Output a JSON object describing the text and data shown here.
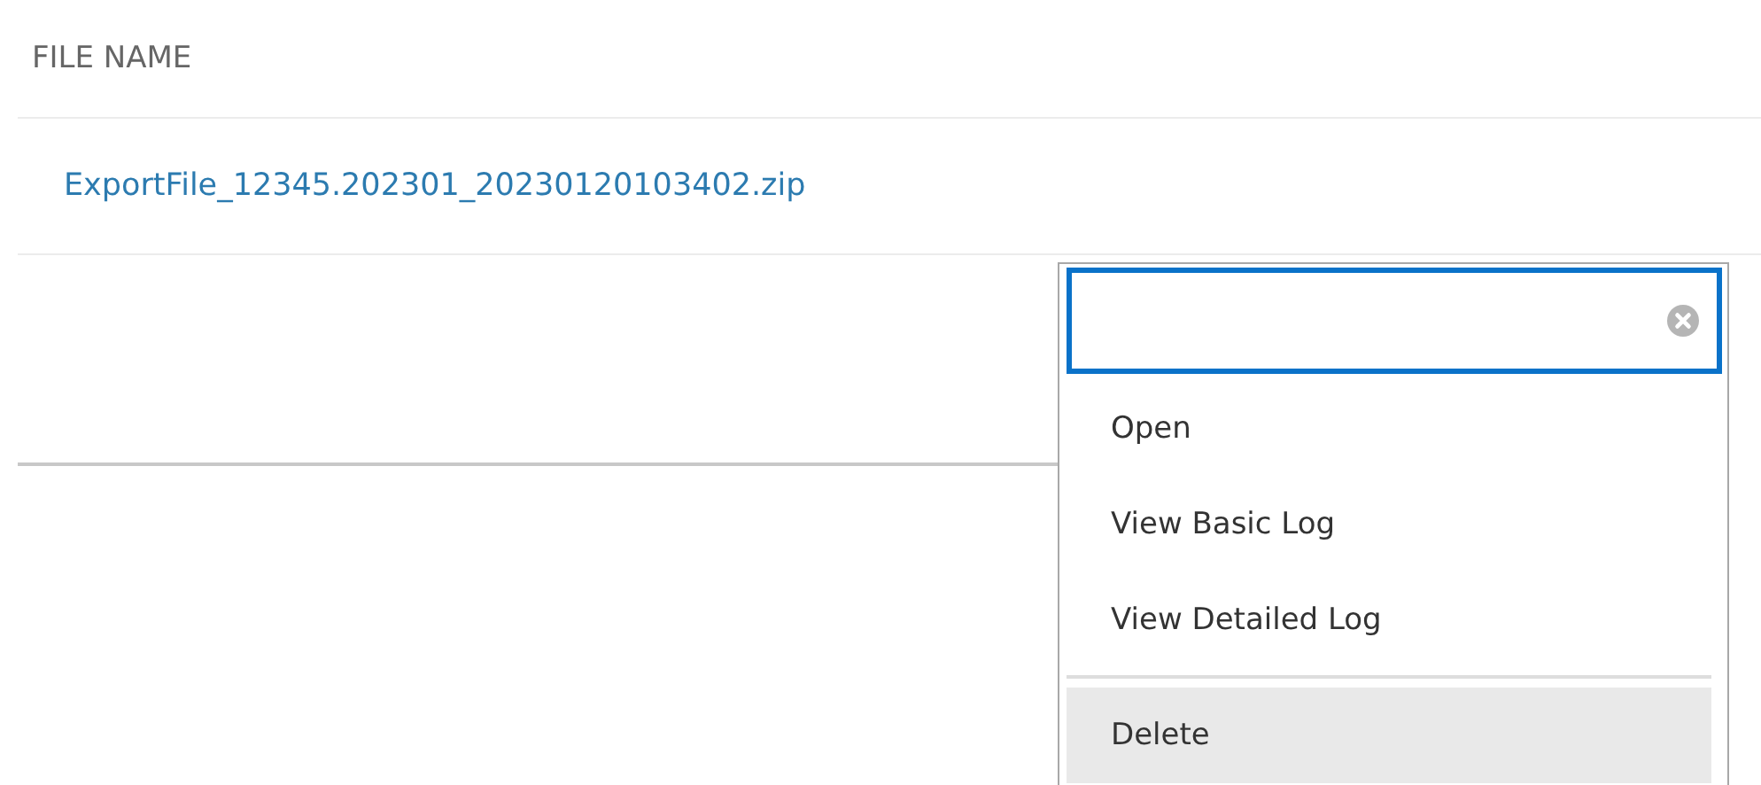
{
  "table": {
    "columns": [
      "FILE NAME"
    ],
    "rows": [
      {
        "file_name": "ExportFile_12345.202301_20230120103402.zip"
      }
    ]
  },
  "menu": {
    "items": [
      {
        "label": "Open",
        "selected": false,
        "divider_before": false
      },
      {
        "label": "View Basic Log",
        "selected": false,
        "divider_before": false
      },
      {
        "label": "View Detailed Log",
        "selected": false,
        "divider_before": false
      },
      {
        "label": "Delete",
        "selected": true,
        "divider_before": true
      }
    ]
  }
}
